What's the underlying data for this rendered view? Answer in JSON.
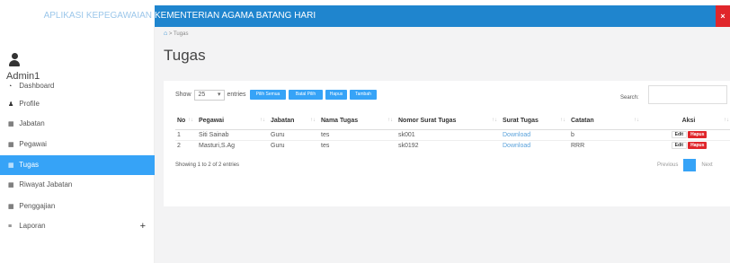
{
  "app": {
    "title_prefix": "APLIKASI KEPEGAWAIAN",
    "title": "KEMENTERIAN AGAMA BATANG HARI",
    "close_glyph": "×"
  },
  "user": {
    "name": "Admin1"
  },
  "sidebar": {
    "items": [
      {
        "label": "Dashboard",
        "icon": "tachometer-icon",
        "glyph": "◔"
      },
      {
        "label": "Profile",
        "icon": "user-icon",
        "glyph": "♟"
      },
      {
        "label": "Jabatan",
        "icon": "table-icon",
        "glyph": "▦"
      },
      {
        "label": "Pegawai",
        "icon": "table-icon",
        "glyph": "▦"
      },
      {
        "label": "Tugas",
        "icon": "table-icon",
        "glyph": "▦",
        "active": true
      },
      {
        "label": "Riwayat Jabatan",
        "icon": "table-icon",
        "glyph": "▦"
      },
      {
        "label": "Penggajian",
        "icon": "table-icon",
        "glyph": "▦"
      },
      {
        "label": "Laporan",
        "icon": "bars-icon",
        "glyph": "≡",
        "expand": "+"
      }
    ]
  },
  "breadcrumb": {
    "home_glyph": "⌂",
    "separator": ">",
    "current": "Tugas"
  },
  "page": {
    "title": "Tugas"
  },
  "table_controls": {
    "show_label": "Show",
    "entries_value": "25",
    "entries_label": "entries",
    "buttons": [
      "Pilih Semua",
      "Batal Pilih",
      "Hapus",
      "Tambah"
    ],
    "search_label": "Search:"
  },
  "table": {
    "headers": [
      "No",
      "Pegawai",
      "Jabatan",
      "Nama Tugas",
      "Nomor Surat Tugas",
      "Surat Tugas",
      "Catatan",
      "Aksi"
    ],
    "rows": [
      [
        "1",
        "Siti Sainab",
        "Guru",
        "tes",
        "sk001",
        "Download",
        "b"
      ],
      [
        "2",
        "Masturi,S.Ag",
        "Guru",
        "tes",
        "sk0192",
        "Download",
        "RRR"
      ]
    ],
    "edit_label": "Edit",
    "delete_label": "Hapus"
  },
  "footer": {
    "info": "Showing 1 to 2 of 2 entries",
    "prev": "Previous",
    "page": "1",
    "next": "Next"
  },
  "colors": {
    "accent": "#36a3f7",
    "topbar": "#1f85ce",
    "danger": "#e0262b"
  }
}
